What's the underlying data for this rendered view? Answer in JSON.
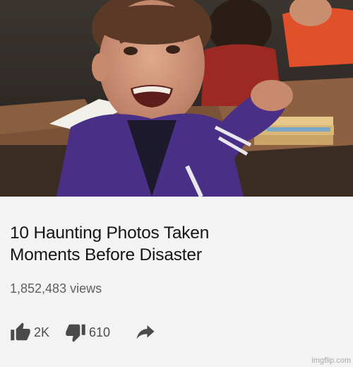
{
  "video": {
    "title_line1": "10 Haunting Photos Taken",
    "title_line2": "Moments Before Disaster",
    "views": "1,852,483 views",
    "likes": "2K",
    "dislikes": "610",
    "thumbnail_icon": "classroom-boy-thumbnail"
  },
  "icons": {
    "like": "thumb-up-icon",
    "dislike": "thumb-down-icon",
    "share": "share-arrow-icon"
  },
  "watermark": "imgflip.com",
  "colors": {
    "background": "#f3f3f3",
    "title": "#151515",
    "secondary": "#5f5f5f",
    "icon": "#4a4a4a"
  }
}
